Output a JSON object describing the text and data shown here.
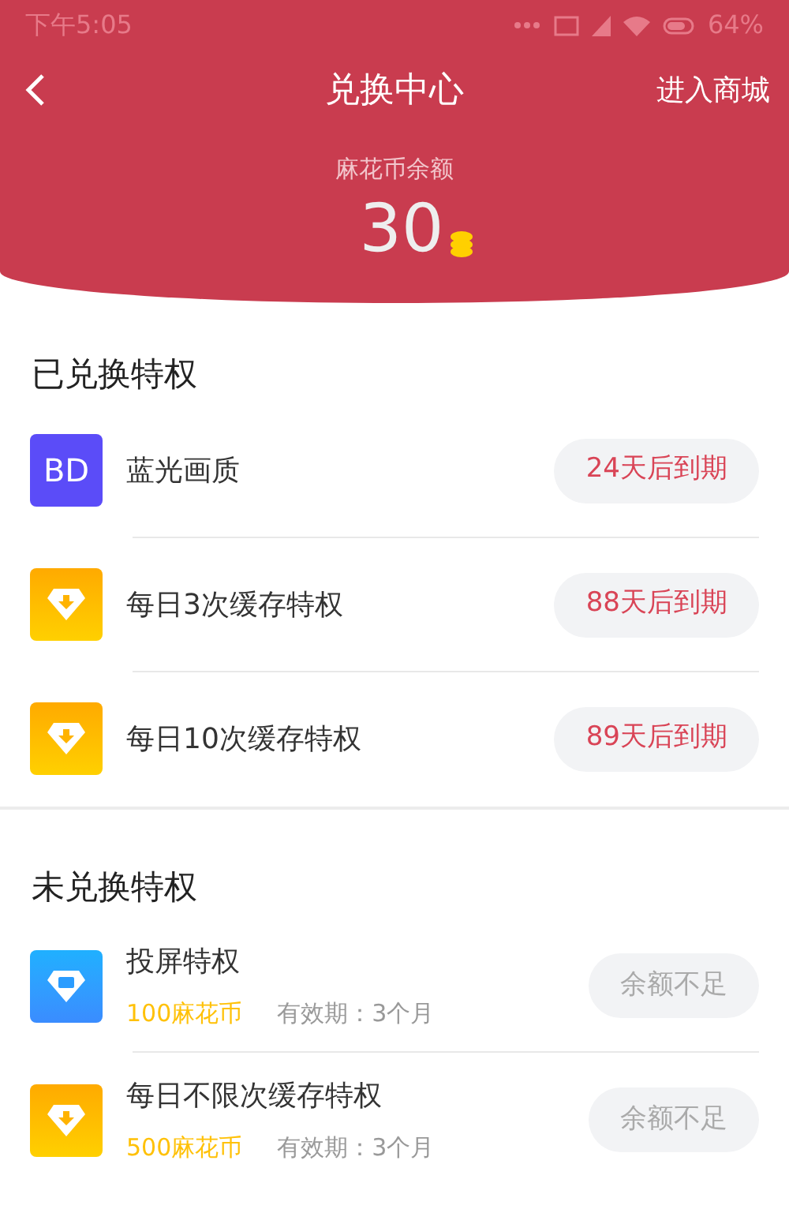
{
  "status_bar": {
    "time": "下午5:05",
    "battery": "64%"
  },
  "header": {
    "title": "兑换中心",
    "action": "进入商城",
    "balance_label": "麻花币余额",
    "balance": "30"
  },
  "sections": [
    {
      "title": "已兑换特权",
      "items": [
        {
          "kind": "bd",
          "icon_text": "BD",
          "name": "蓝光画质",
          "button": "24天后到期",
          "disabled": false
        },
        {
          "kind": "download",
          "name": "每日3次缓存特权",
          "button": "88天后到期",
          "disabled": false
        },
        {
          "kind": "download",
          "name": "每日10次缓存特权",
          "button": "89天后到期",
          "disabled": false
        }
      ]
    },
    {
      "title": "未兑换特权",
      "items": [
        {
          "kind": "cast",
          "name": "投屏特权",
          "price": "100麻花币",
          "validity": "有效期：3个月",
          "button": "余额不足",
          "disabled": true
        },
        {
          "kind": "download",
          "name": "每日不限次缓存特权",
          "price": "500麻花币",
          "validity": "有效期：3个月",
          "button": "余额不足",
          "disabled": true
        }
      ]
    }
  ]
}
